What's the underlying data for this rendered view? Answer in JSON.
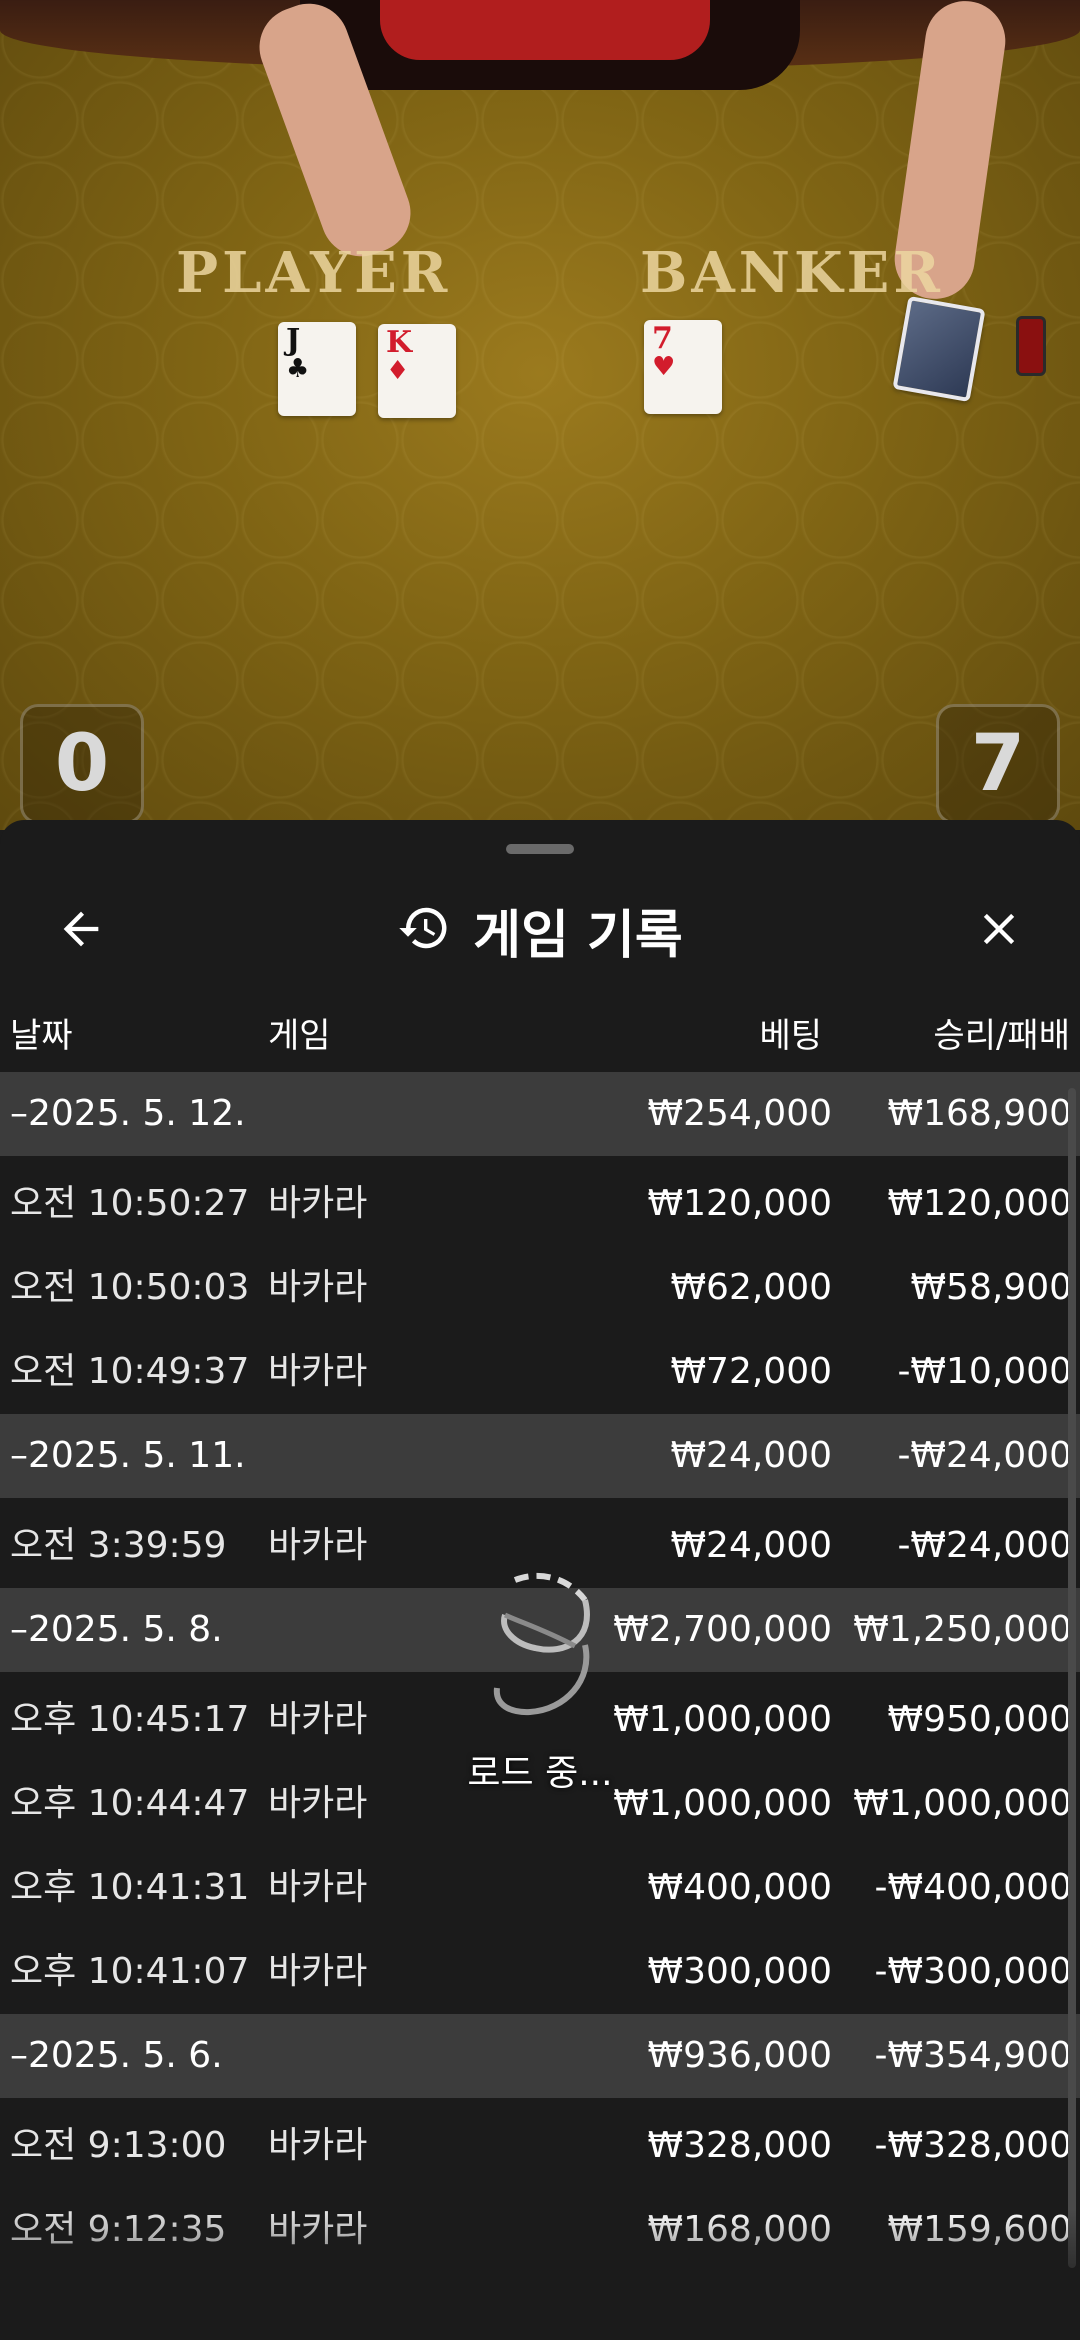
{
  "table": {
    "player_label": "PLAYER",
    "banker_label": "BANKER",
    "player_cards": [
      {
        "rank": "J",
        "suit": "♣",
        "color": "black"
      },
      {
        "rank": "K",
        "suit": "♦",
        "color": "red"
      }
    ],
    "banker_cards": [
      {
        "rank": "7",
        "suit": "♥",
        "color": "red"
      }
    ],
    "player_score": "0",
    "banker_score": "7"
  },
  "history": {
    "title": "게임 기록",
    "icons": {
      "back": "arrow-left-icon",
      "title": "history-icon",
      "close": "close-icon"
    },
    "columns": {
      "date": "날짜",
      "game": "게임",
      "bet": "베팅",
      "result": "승리/패배"
    },
    "groups": [
      {
        "date": "–2025. 5. 12.",
        "bet": "₩254,000",
        "result": "₩168,900",
        "rows": [
          {
            "time": "오전 10:50:27",
            "game": "바카라",
            "bet": "₩120,000",
            "result": "₩120,000"
          },
          {
            "time": "오전 10:50:03",
            "game": "바카라",
            "bet": "₩62,000",
            "result": "₩58,900"
          },
          {
            "time": "오전 10:49:37",
            "game": "바카라",
            "bet": "₩72,000",
            "result": "-₩10,000"
          }
        ]
      },
      {
        "date": "–2025. 5. 11.",
        "bet": "₩24,000",
        "result": "-₩24,000",
        "rows": [
          {
            "time": "오전 3:39:59",
            "game": "바카라",
            "bet": "₩24,000",
            "result": "-₩24,000"
          }
        ]
      },
      {
        "date": "–2025. 5. 8.",
        "bet": "₩2,700,000",
        "result": "₩1,250,000",
        "rows": [
          {
            "time": "오후 10:45:17",
            "game": "바카라",
            "bet": "₩1,000,000",
            "result": "₩950,000"
          },
          {
            "time": "오후 10:44:47",
            "game": "바카라",
            "bet": "₩1,000,000",
            "result": "₩1,000,000"
          },
          {
            "time": "오후 10:41:31",
            "game": "바카라",
            "bet": "₩400,000",
            "result": "-₩400,000"
          },
          {
            "time": "오후 10:41:07",
            "game": "바카라",
            "bet": "₩300,000",
            "result": "-₩300,000"
          }
        ]
      },
      {
        "date": "–2025. 5. 6.",
        "bet": "₩936,000",
        "result": "-₩354,900",
        "rows": [
          {
            "time": "오전 9:13:00",
            "game": "바카라",
            "bet": "₩328,000",
            "result": "-₩328,000"
          },
          {
            "time": "오전 9:12:35",
            "game": "바카라",
            "bet": "₩168,000",
            "result": "₩159,600"
          }
        ]
      }
    ],
    "loading_text": "로드 중..."
  }
}
